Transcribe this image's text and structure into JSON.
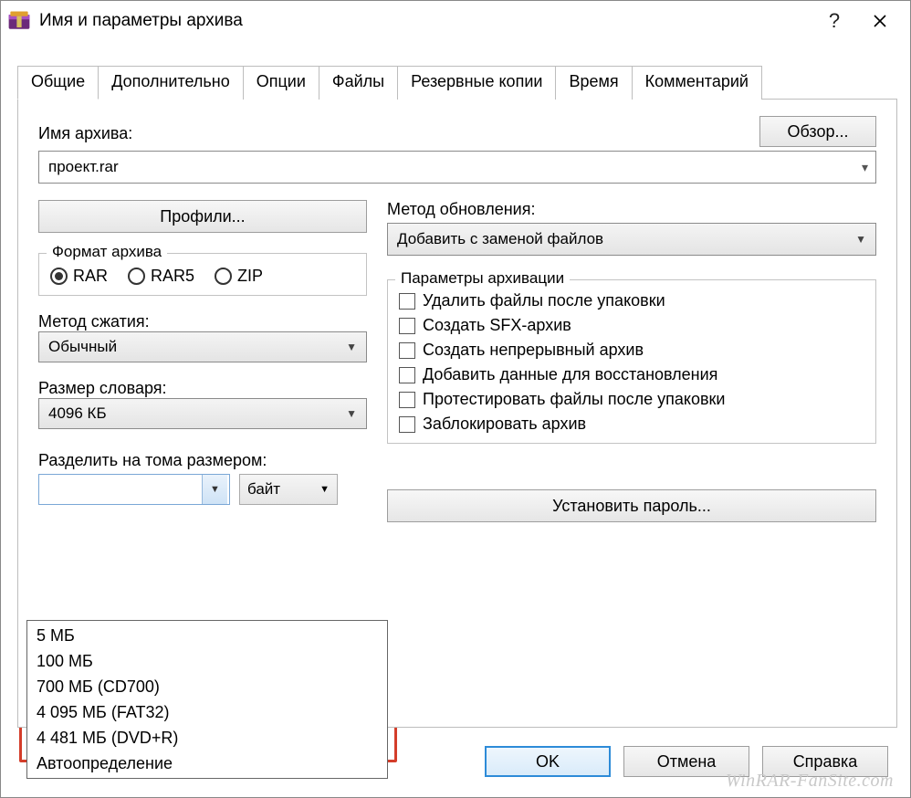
{
  "window": {
    "title": "Имя и параметры архива",
    "help": "?",
    "close": "✕"
  },
  "tabs": [
    "Общие",
    "Дополнительно",
    "Опции",
    "Файлы",
    "Резервные копии",
    "Время",
    "Комментарий"
  ],
  "archive_name": {
    "label": "Имя архива:",
    "value": "проект.rar",
    "browse": "Обзор..."
  },
  "profiles_btn": "Профили...",
  "update": {
    "label": "Метод обновления:",
    "value": "Добавить с заменой файлов"
  },
  "format": {
    "legend": "Формат архива",
    "options": [
      "RAR",
      "RAR5",
      "ZIP"
    ],
    "selected": "RAR"
  },
  "method": {
    "label": "Метод сжатия:",
    "value": "Обычный"
  },
  "dict": {
    "label": "Размер словаря:",
    "value": "4096 КБ"
  },
  "split": {
    "label": "Разделить на тома размером:",
    "value": "",
    "unit": "байт",
    "options": [
      "5 МБ",
      "100 МБ",
      "700 МБ  (CD700)",
      "4 095 МБ  (FAT32)",
      "4 481 МБ  (DVD+R)",
      "Автоопределение"
    ]
  },
  "params": {
    "legend": "Параметры архивации",
    "items": [
      "Удалить файлы после упаковки",
      "Создать SFX-архив",
      "Создать непрерывный архив",
      "Добавить данные для восстановления",
      "Протестировать файлы после упаковки",
      "Заблокировать архив"
    ]
  },
  "password_btn": "Установить пароль...",
  "footer": {
    "ok": "OK",
    "cancel": "Отмена",
    "help": "Справка"
  },
  "watermark": "WinRAR-FanSite.com"
}
